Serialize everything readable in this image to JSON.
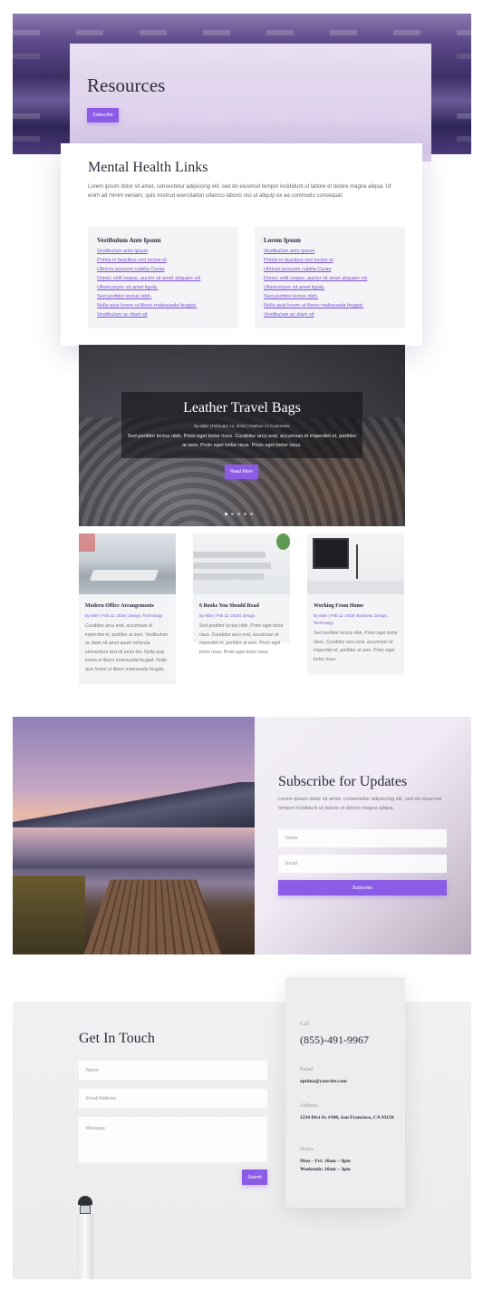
{
  "hero": {
    "title": "Resources",
    "button": "Subscribe"
  },
  "links": {
    "title": "Mental Health Links",
    "body": "Lorem ipsum dolor sit amet, consectetur adipiscing elit, sed do eiusmod tempor incididunt ut labore et dolore magna aliqua. Ut enim ad minim veniam, quis nostrud exercitation ullamco laboris nisi ut aliquip ex ea commodo consequat.",
    "groups": [
      {
        "heading": "Vestibulum Ante Ipsum",
        "items": [
          "Vestibulum ante ipsum",
          "Primis in faucibus orci luctus et",
          "Ultrices posuere cubilia Curae",
          "Donec velit neque, auctor sit amet aliquam vel",
          "Ullamcorper sit amet ligula.",
          "Sed porttitor lectus nibh.",
          "Nulla quis lorem ut libero malesuada feugiat.",
          "Vestibulum ac diam sit"
        ]
      },
      {
        "heading": "Lorem Ipsum",
        "items": [
          "Vestibulum ante ipsum",
          "Primis in faucibus orci luctus et",
          "Ultrices posuere cubilia Curae",
          "Donec velit neque, auctor sit amet aliquam vel",
          "Ullamcorper sit amet ligula.",
          "Sed porttitor lectus nibh.",
          "Nulla quis lorem ut libero malesuada feugiat.",
          "Vestibulum ac diam sit"
        ]
      }
    ]
  },
  "slider": {
    "title": "Leather Travel Bags",
    "meta": "by elder | February 12, 2018 | Fashion | 0 Comments",
    "text": "Sed porttitor lectus nibh. Proin eget tortor risus. Curabitur arcu erat, accumsan id imperdiet et, porttitor at sem. Proin eget tortor risus. Proin eget tortor risus.",
    "button": "Read More"
  },
  "posts": [
    {
      "title": "Modern Office Arrangements",
      "meta": "by elder | Feb 12, 2018 | Design, Technology",
      "excerpt": "Curabitur arcu erat, accumsan id imperdiet et, porttitor at sem. Vestibulum ac diam sit amet quam vehicula elementum sed sit amet dui. Nulla quis lorem ut libero malesuada feugiat. Nulla quis lorem ut libero malesuada feugiat."
    },
    {
      "title": "6 Books You Should Read",
      "meta": "by elder | Feb 12, 2018 | Design",
      "excerpt": "Sed porttitor lectus nibh. Proin eget tortor risus. Curabitur arcu erat, accumsan id imperdiet et, porttitor at sem. Proin eget tortor risus. Proin eget tortor risus."
    },
    {
      "title": "Working From Home",
      "meta": "by elder | Feb 12, 2018 | Business, Design, Technology",
      "excerpt": "Sed porttitor lectus nibh. Proin eget tortor risus. Curabitur arcu erat, accumsan id imperdiet et, porttitor at sem. Proin eget tortor risus."
    }
  ],
  "subscribe": {
    "title": "Subscribe for Updates",
    "text": "Lorem ipsum dolor sit amet, consectetur adipiscing elit, sed do eiusmod tempor incididunt ut labore et dolore magna aliqua.",
    "name_placeholder": "Name",
    "email_placeholder": "Email",
    "button": "Subscribe"
  },
  "contact": {
    "title": "Get In Touch",
    "name_placeholder": "Name",
    "email_placeholder": "Email Address",
    "message_placeholder": "Message",
    "button": "Submit",
    "call_label": "Call",
    "phone": "(855)-491-9967",
    "email_label": "Email",
    "email": "optima@yoursite.com",
    "address_label": "Address",
    "address": "1234 Divi St. #100, San Francisco, CA 93150",
    "hours_label": "Hours",
    "hours_1": "Mon – Fri: 10am – 9pm",
    "hours_2": "Weekends: 10am – 3pm"
  },
  "colors": {
    "accent": "#8c5ce6",
    "link": "#7b52d6",
    "heading": "#2b2b3b"
  }
}
